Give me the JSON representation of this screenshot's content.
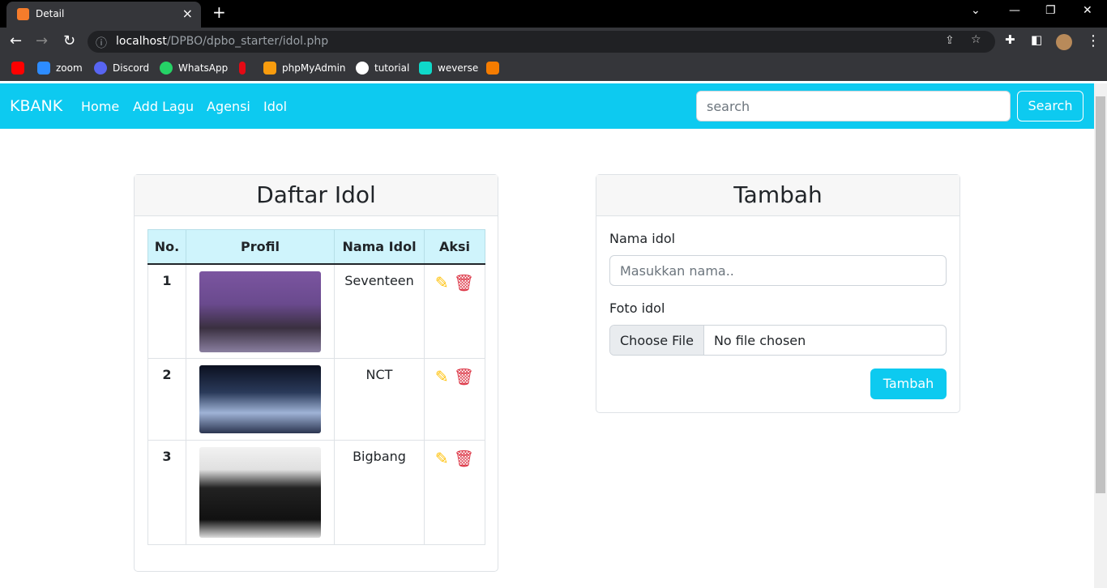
{
  "browser": {
    "tab_title": "Detail",
    "url_host": "localhost",
    "url_path": "/DPBO/dpbo_starter/idol.php",
    "bookmarks": [
      {
        "label": "",
        "color": "#ff0000"
      },
      {
        "label": "zoom",
        "color": "#2d8cff"
      },
      {
        "label": "Discord",
        "color": "#5865f2"
      },
      {
        "label": "WhatsApp",
        "color": "#25d366"
      },
      {
        "label": "",
        "color": "#e50914"
      },
      {
        "label": "phpMyAdmin",
        "color": "#f89c0e"
      },
      {
        "label": "tutorial",
        "color": "#ffffff"
      },
      {
        "label": "weverse",
        "color": "#0fd9c9"
      },
      {
        "label": "",
        "color": "#f57c00"
      }
    ]
  },
  "navbar": {
    "brand": "KBANK",
    "links": [
      "Home",
      "Add Lagu",
      "Agensi",
      "Idol"
    ],
    "search_placeholder": "search",
    "search_button": "Search",
    "color": "#0dcaf0"
  },
  "list": {
    "title": "Daftar Idol",
    "headers": [
      "No.",
      "Profil",
      "Nama Idol",
      "Aksi"
    ],
    "rows": [
      {
        "no": "1",
        "name": "Seventeen"
      },
      {
        "no": "2",
        "name": "NCT"
      },
      {
        "no": "3",
        "name": "Bigbang"
      }
    ]
  },
  "form": {
    "title": "Tambah",
    "name_label": "Nama idol",
    "name_placeholder": "Masukkan nama..",
    "photo_label": "Foto idol",
    "choose_file": "Choose File",
    "no_file": "No file chosen",
    "submit": "Tambah"
  }
}
